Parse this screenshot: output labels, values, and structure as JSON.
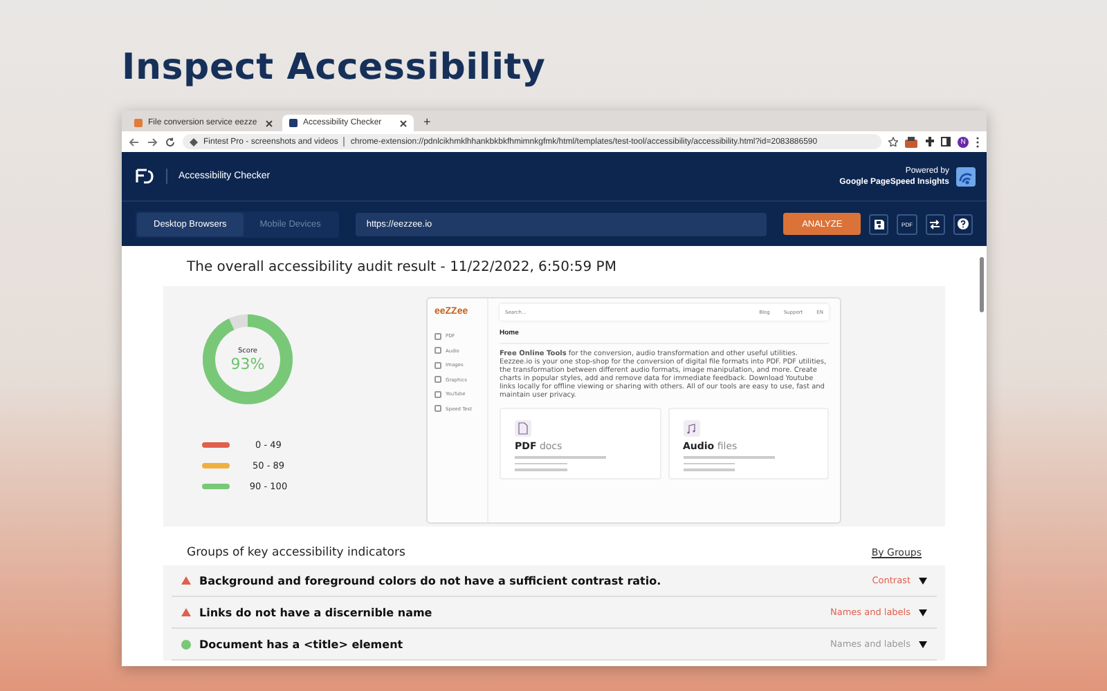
{
  "page_title": "Inspect Accessibility",
  "browser": {
    "tabs": [
      {
        "title": "File conversion service eezze",
        "selected": false
      },
      {
        "title": "Accessibility Checker",
        "selected": true
      }
    ],
    "new_tab": "+",
    "site": "Fintest Pro - screenshots and videos",
    "url": "chrome-extension://pdnlcikhmklhhankbkbkfhmimnkgfmk/html/templates/test-tool/accessibility/accessibility.html?id=2083886590",
    "profile": "N"
  },
  "app": {
    "title": "Accessibility Checker",
    "powered_by": "Powered by",
    "provider": "Google PageSpeed Insights"
  },
  "toolbar": {
    "modes": [
      {
        "label": "Desktop Browsers",
        "selected": true
      },
      {
        "label": "Mobile Devices",
        "selected": false
      }
    ],
    "url": "https://eezzee.io",
    "analyze": "ANALYZE",
    "pdf": "PDF"
  },
  "audit": {
    "heading": "The overall accessibility audit result - 11/22/2022, 6:50:59 PM",
    "score_label": "Score",
    "score": "93%",
    "level": 0.93,
    "legend": [
      {
        "range": "0 - 49",
        "color": "#e0604e"
      },
      {
        "range": "50 - 89",
        "color": "#f0b040"
      },
      {
        "range": "90 - 100",
        "color": "#78c878"
      }
    ],
    "preview": {
      "logo": "eeZZee",
      "search": "Search...",
      "nav": [
        "Blog",
        "Support",
        "EN"
      ],
      "sidebar": [
        "PDF",
        "Audio",
        "Images",
        "Graphics",
        "YouTube",
        "Speed Test"
      ],
      "title": "Home",
      "intro": "**Free Online Tools** for the conversion, audio transformation and other useful utilities. Eezzee.io is your one stop-shop for the conversion of digital file formats into PDF. PDF utilities, the transformation between different audio formats, image manipulation, and more. Create charts in popular styles, add and remove data for immediate feedback. Download Youtube links locally for offline viewing or sharing with others. All of our tools are easy to use, fast and maintain user privacy.",
      "cards": [
        {
          "kind": "document",
          "title": "**PDF** docs"
        },
        {
          "kind": "music",
          "title": "**Audio** files"
        }
      ]
    }
  },
  "indicators": {
    "heading": "Groups of key accessibility indicators",
    "group_link": "By Groups",
    "items": [
      {
        "title": "Background and foreground colors do not have a sufficient contrast ratio.",
        "group": "Contrast",
        "kind": "fail",
        "expanded": false
      },
      {
        "title": "Links do not have a discernible name",
        "group": "Names and labels",
        "kind": "fail",
        "expanded": false
      },
      {
        "title": "Document has a <title> element",
        "group": "Names and labels",
        "kind": "pass",
        "expanded": false
      }
    ]
  }
}
